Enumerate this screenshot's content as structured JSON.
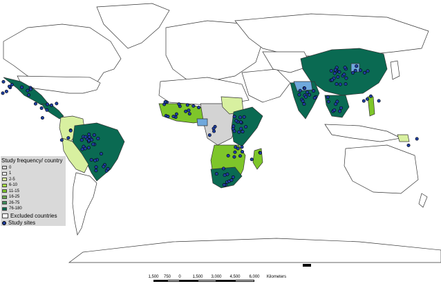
{
  "legend": {
    "title": "Study frequency/ country",
    "classes": [
      {
        "label": "0",
        "color": "#d3d3d3"
      },
      {
        "label": "1",
        "color": "#ffffff"
      },
      {
        "label": "2-5",
        "color": "#d8f0a0"
      },
      {
        "label": "6-10",
        "color": "#a6e040"
      },
      {
        "label": "11-15",
        "color": "#7ec62a"
      },
      {
        "label": "16-25",
        "color": "#6aa84f"
      },
      {
        "label": "26-75",
        "color": "#3e8e5c"
      },
      {
        "label": "76-180",
        "color": "#0a6a52"
      }
    ],
    "excluded_label": "Excluded countries",
    "sites_label": "Study sites",
    "excluded_color": "#ffffff",
    "site_color": "#1f3fa0"
  },
  "scale": {
    "labels": [
      "1,500",
      "750",
      "0",
      "1,500",
      "3,000",
      "4,500",
      "6,000"
    ],
    "unit": "Kilometers"
  },
  "colors": {
    "ocean": "#ffffff",
    "land_default": "#ffffff",
    "outline": "#333333",
    "highlight_blue": "#6fa8dc"
  }
}
